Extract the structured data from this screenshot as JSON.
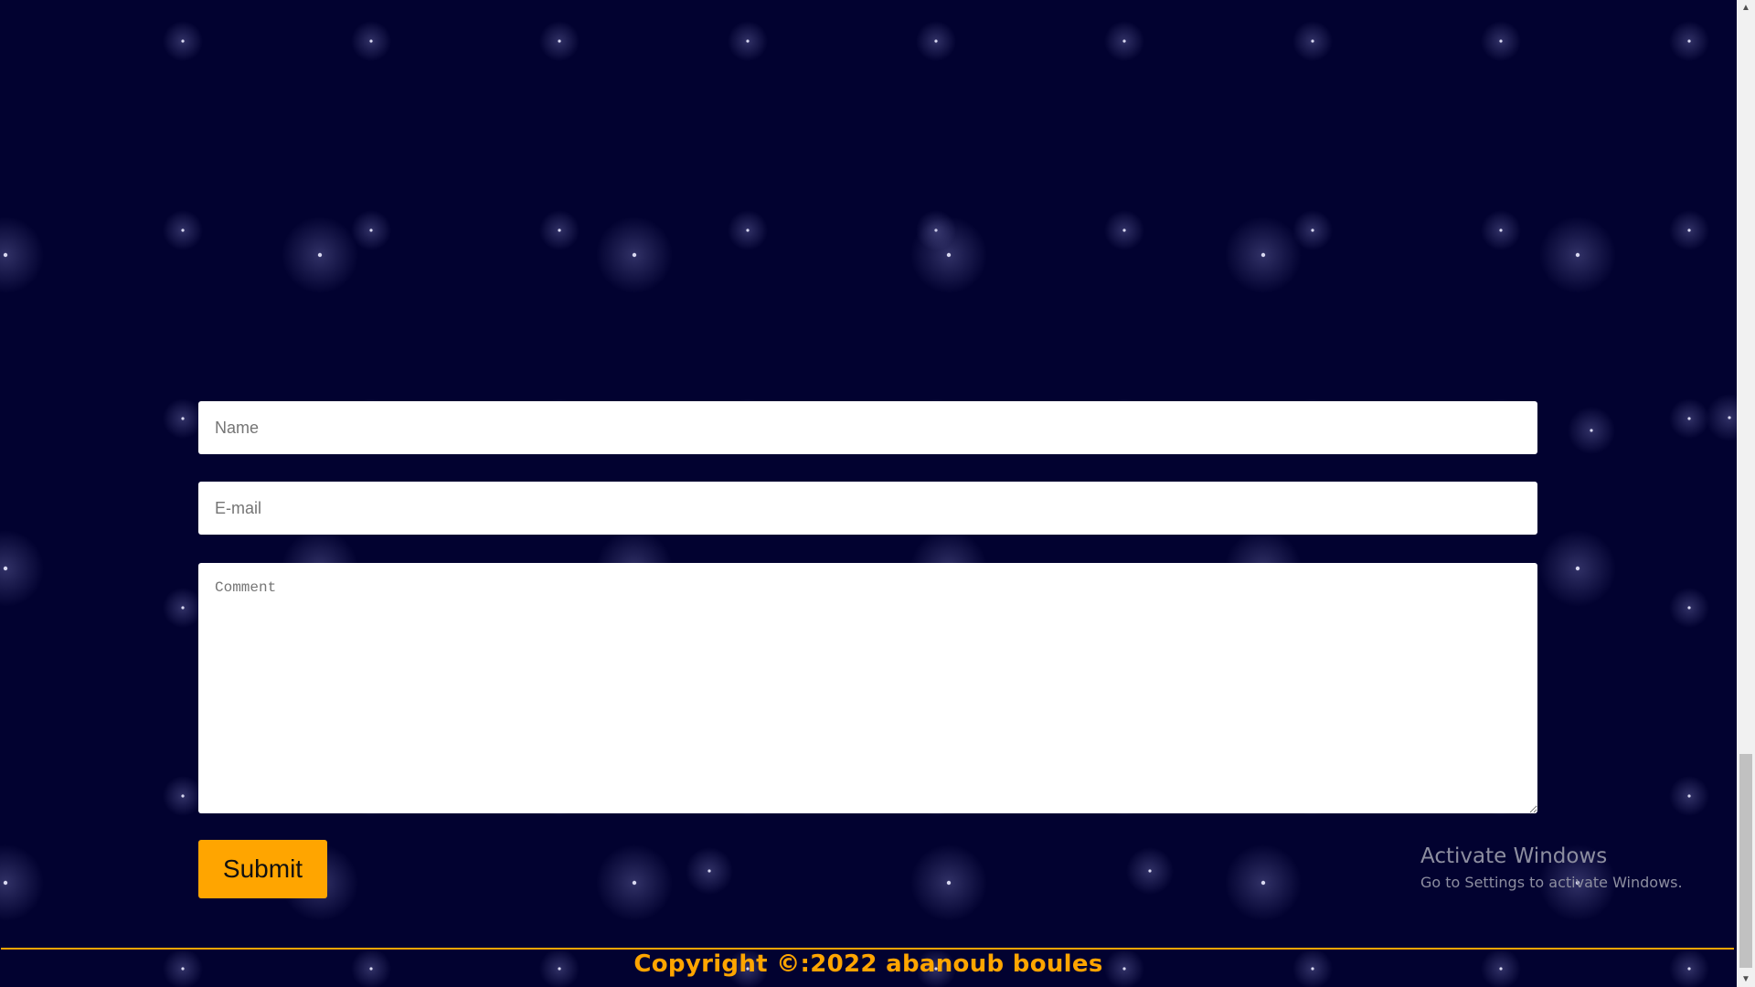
{
  "contact_form": {
    "name_placeholder": "Name",
    "email_placeholder": "E-mail",
    "comment_placeholder": "Comment",
    "submit_label": "Submit"
  },
  "watermark": {
    "title": "Activate Windows",
    "subtitle": "Go to Settings to activate Windows."
  },
  "footer": {
    "copyright": "Copyright ©:2022 abanoub boules"
  },
  "scrollbar": {
    "up_icon": "▲",
    "down_icon": "▼"
  },
  "colors": {
    "background": "#020230",
    "accent": "#ffa500"
  }
}
